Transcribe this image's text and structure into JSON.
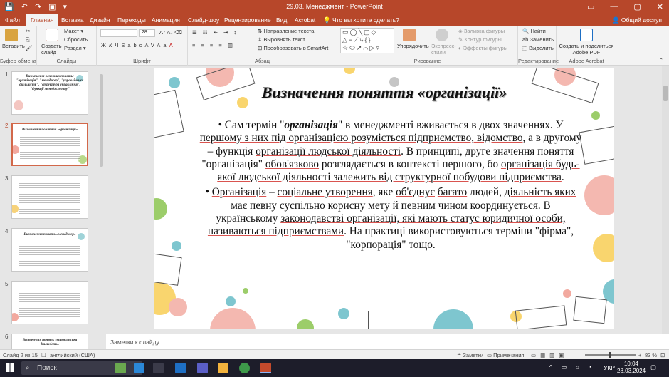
{
  "window": {
    "title": "29.03. Менеджмент  -  PowerPoint",
    "qat": [
      "💾",
      "↶",
      "↷",
      "▣",
      "▾"
    ],
    "controls": [
      "▭",
      "—",
      "▢",
      "✕"
    ]
  },
  "tabs": [
    "Файл",
    "Главная",
    "Вставка",
    "Дизайн",
    "Переходы",
    "Анимация",
    "Слайд-шоу",
    "Рецензирование",
    "Вид",
    "Acrobat",
    "Что вы хотите сделать?"
  ],
  "share_label": "Общий доступ",
  "ribbon": {
    "clipboard": {
      "paste": "Вставить",
      "label": "Буфер обмена"
    },
    "slides": {
      "create": "Создать слайд",
      "layout": "Макет",
      "reset": "Сбросить",
      "section": "Раздел",
      "label": "Слайды"
    },
    "font": {
      "size": "28",
      "label": "Шрифт",
      "styles": [
        "Ж",
        "К",
        "Ч",
        "S",
        "abc",
        "AV",
        "Aa",
        "A"
      ]
    },
    "paragraph": {
      "text_direction": "Направление текста",
      "align_text": "Выровнять текст",
      "smartart": "Преобразовать в SmartArt",
      "label": "Абзац"
    },
    "drawing": {
      "arrange": "Упорядочить",
      "quick_styles": "Экспресс-стили",
      "fill": "Заливка фигуры",
      "outline": "Контур фигуры",
      "effects": "Эффекты фигуры",
      "label": "Рисование"
    },
    "editing": {
      "find": "Найти",
      "replace": "Заменить",
      "select": "Выделить",
      "label": "Редактирование"
    },
    "acrobat": {
      "create_share": "Создать и поделиться Adobe PDF",
      "label": "Adobe Acrobat"
    }
  },
  "thumbnails": [
    {
      "num": "1",
      "title": "Визначення основних понять: \"організація\", \"менеджер\", \"управлінська діяльність\", \"структура управління\", \"функції менеджменту\""
    },
    {
      "num": "2",
      "title": "Визначення поняття «організації»"
    },
    {
      "num": "3",
      "title": ""
    },
    {
      "num": "4",
      "title": "Визначення понять «менеджер»"
    },
    {
      "num": "5",
      "title": ""
    },
    {
      "num": "6",
      "title": "Визначення понять «управлінська діяльність»"
    }
  ],
  "slide": {
    "title": "Визначення поняття «організації»",
    "bullets": [
      {
        "segments": [
          {
            "t": "Сам термін \"",
            "s": ""
          },
          {
            "t": "організація",
            "s": "em"
          },
          {
            "t": "\" в менеджменті вживається в двох значеннях. У ",
            "s": ""
          },
          {
            "t": "першому з них під організацією розуміється підприємство, відомство",
            "s": "ul"
          },
          {
            "t": ", а в другому – функція ",
            "s": ""
          },
          {
            "t": "організації людської діяльності",
            "s": "ul"
          },
          {
            "t": ". В принципі, друге значення поняття \"організація\" ",
            "s": ""
          },
          {
            "t": "обов'язково",
            "s": "ul"
          },
          {
            "t": " розглядається в контексті першого, бо ",
            "s": ""
          },
          {
            "t": "організація будь-якої людської діяльності залежить від структурної побудови підприємства",
            "s": "ul"
          },
          {
            "t": ".",
            "s": ""
          }
        ]
      },
      {
        "segments": [
          {
            "t": "Організація",
            "s": "ul"
          },
          {
            "t": " – ",
            "s": ""
          },
          {
            "t": "соціальне утворення",
            "s": "ul"
          },
          {
            "t": ", яке ",
            "s": ""
          },
          {
            "t": "об'єднує",
            "s": "ul"
          },
          {
            "t": " ",
            "s": ""
          },
          {
            "t": "багато",
            "s": "ul"
          },
          {
            "t": " людей, ",
            "s": ""
          },
          {
            "t": "діяльність яких має певну суспільно корисну мету й певним чином координується",
            "s": "ul"
          },
          {
            "t": ". В українському ",
            "s": ""
          },
          {
            "t": "законодавстві організації, які мають статус юридичної особи, називаються підприємствами",
            "s": "ul"
          },
          {
            "t": ". На практиці використовуються терміни \"фірма\", \"корпорація\" ",
            "s": ""
          },
          {
            "t": "тощо",
            "s": "ul"
          },
          {
            "t": ".",
            "s": ""
          }
        ]
      }
    ]
  },
  "notes_placeholder": "Заметки к слайду",
  "status": {
    "slide_of": "Слайд 2 из 15",
    "language": "английский (США)",
    "notes": "Заметки",
    "comments": "Примечания",
    "zoom": "83 %"
  },
  "taskbar": {
    "search": "Поиск",
    "lang": "УКР",
    "time": "10:04",
    "date": "28.03.2024"
  },
  "colors": {
    "accent": "#b7472a",
    "taskbar": "#1d1d2a"
  }
}
